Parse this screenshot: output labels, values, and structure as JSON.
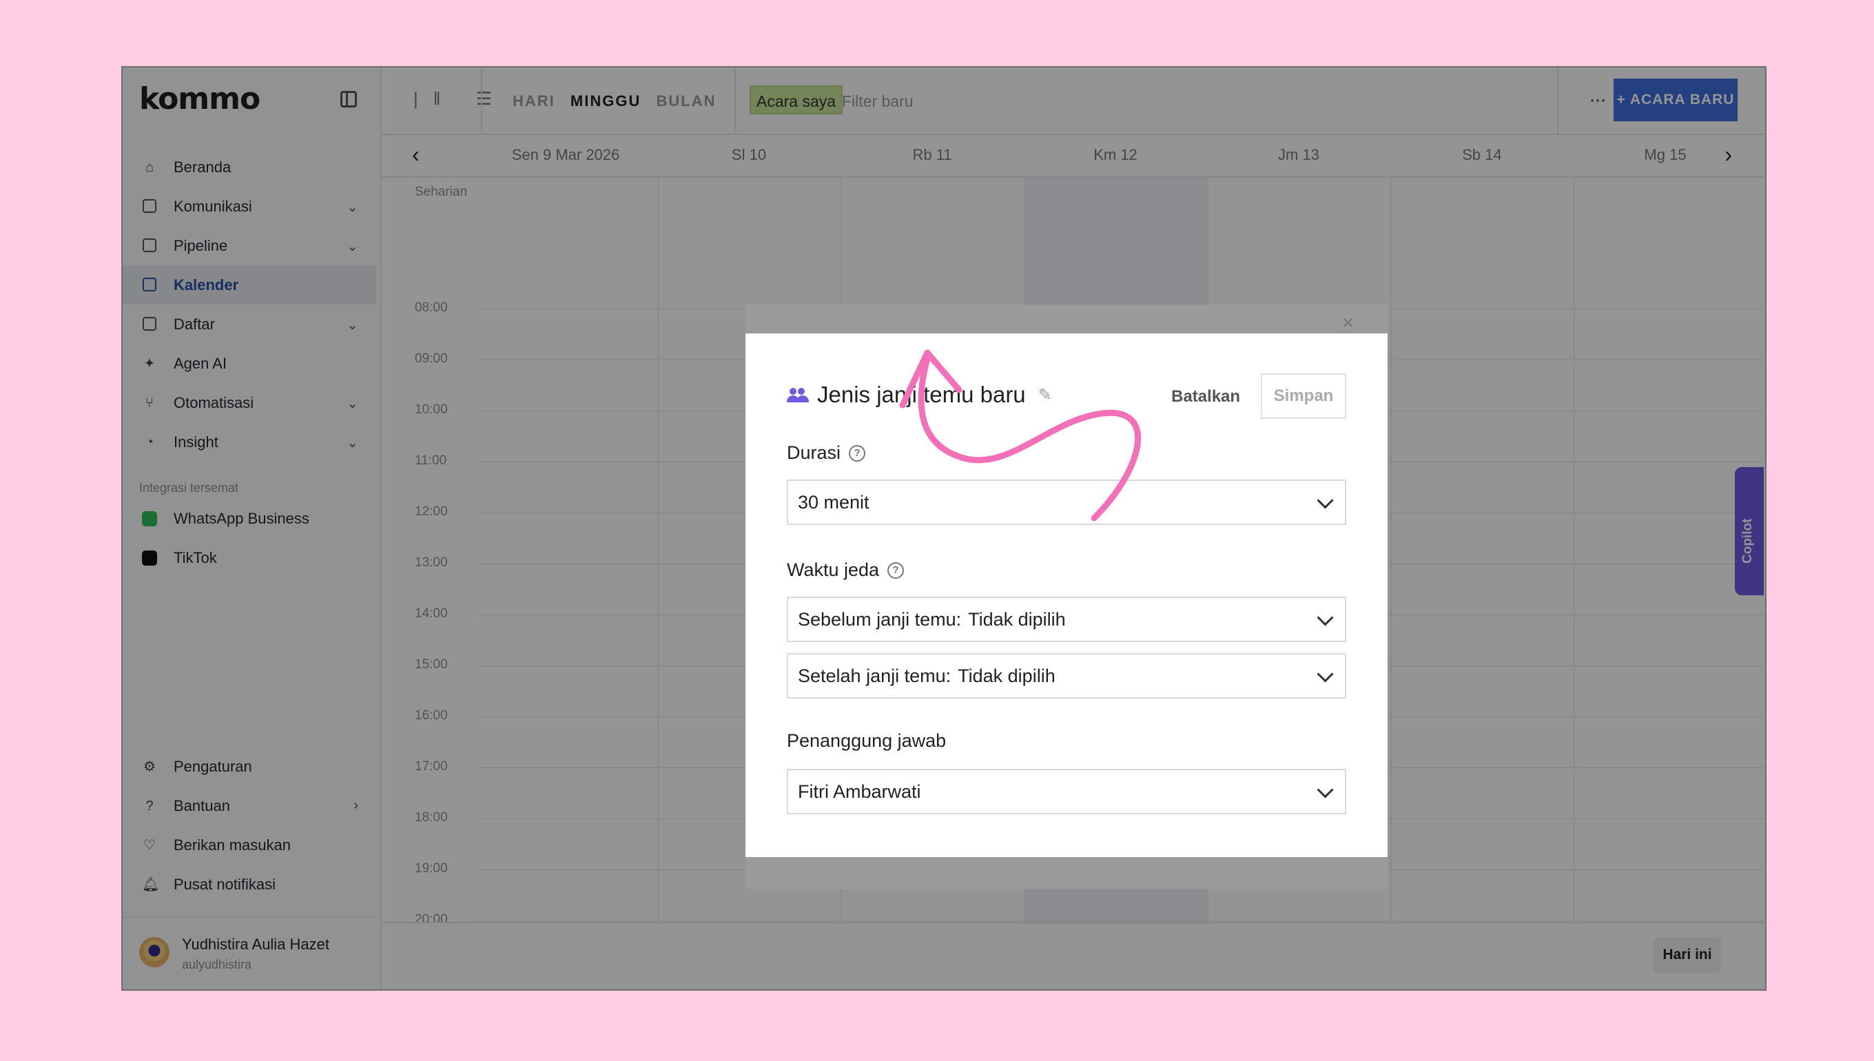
{
  "brand": "kommo",
  "sidebar": {
    "items": [
      {
        "label": "Beranda",
        "icon": "home-icon",
        "chevron": false
      },
      {
        "label": "Komunikasi",
        "icon": "chat-icon",
        "chevron": true
      },
      {
        "label": "Pipeline",
        "icon": "pipeline-icon",
        "chevron": true
      },
      {
        "label": "Kalender",
        "icon": "calendar-icon",
        "chevron": false,
        "active": true
      },
      {
        "label": "Daftar",
        "icon": "list-icon",
        "chevron": true
      },
      {
        "label": "Agen AI",
        "icon": "sparkle-icon",
        "chevron": false
      },
      {
        "label": "Otomatisasi",
        "icon": "automation-icon",
        "chevron": true
      },
      {
        "label": "Insight",
        "icon": "chart-icon",
        "chevron": true
      }
    ],
    "pinned_label": "Integrasi tersemat",
    "pinned": [
      {
        "label": "WhatsApp Business",
        "icon": "whatsapp-icon"
      },
      {
        "label": "TikTok",
        "icon": "tiktok-icon"
      }
    ],
    "bottom_items": [
      {
        "label": "Pengaturan",
        "icon": "gear-icon"
      },
      {
        "label": "Bantuan",
        "icon": "help-icon"
      },
      {
        "label": "Berikan masukan",
        "icon": "heart-icon"
      },
      {
        "label": "Pusat notifikasi",
        "icon": "bell-icon"
      }
    ],
    "user": {
      "name": "Yudhistira Aulia Hazet",
      "handle": "aulyudhistira"
    }
  },
  "toolbar": {
    "views": [
      "HARI",
      "MINGGU",
      "BULAN"
    ],
    "selected_view": "MINGGU",
    "filter_chip": "Acara saya",
    "filter_placeholder": "Filter baru",
    "more_label": "···",
    "new_event_label": "+ ACARA BARU"
  },
  "calendar": {
    "days": [
      "Sen 9 Mar 2026",
      "Sl 10",
      "Rb 11",
      "Km 12",
      "Jm 13",
      "Sb 14",
      "Mg 15"
    ],
    "all_day_label": "Seharian",
    "hours": [
      "08:00",
      "09:00",
      "10:00",
      "11:00",
      "12:00",
      "13:00",
      "14:00",
      "15:00",
      "16:00",
      "17:00",
      "18:00",
      "19:00",
      "20:00"
    ],
    "today_label": "Hari ini",
    "copilot_label": "Copilot"
  },
  "modal": {
    "title": "Jenis janji temu baru",
    "cancel_label": "Batalkan",
    "save_label": "Simpan",
    "duration_label": "Durasi",
    "duration_value": "30 menit",
    "buffer_label": "Waktu jeda",
    "before_prefix": "Sebelum janji temu:",
    "before_value": "Tidak dipilih",
    "after_prefix": "Setelah janji temu:",
    "after_value": "Tidak dipilih",
    "owner_label": "Penanggung jawab",
    "owner_value": "Fitri Ambarwati"
  },
  "colors": {
    "accent": "#3e6ede",
    "annotation": "#f36fb8",
    "background": "#ffcce3",
    "filter_chip": "#c9e79a",
    "copilot": "#6e5be0"
  }
}
